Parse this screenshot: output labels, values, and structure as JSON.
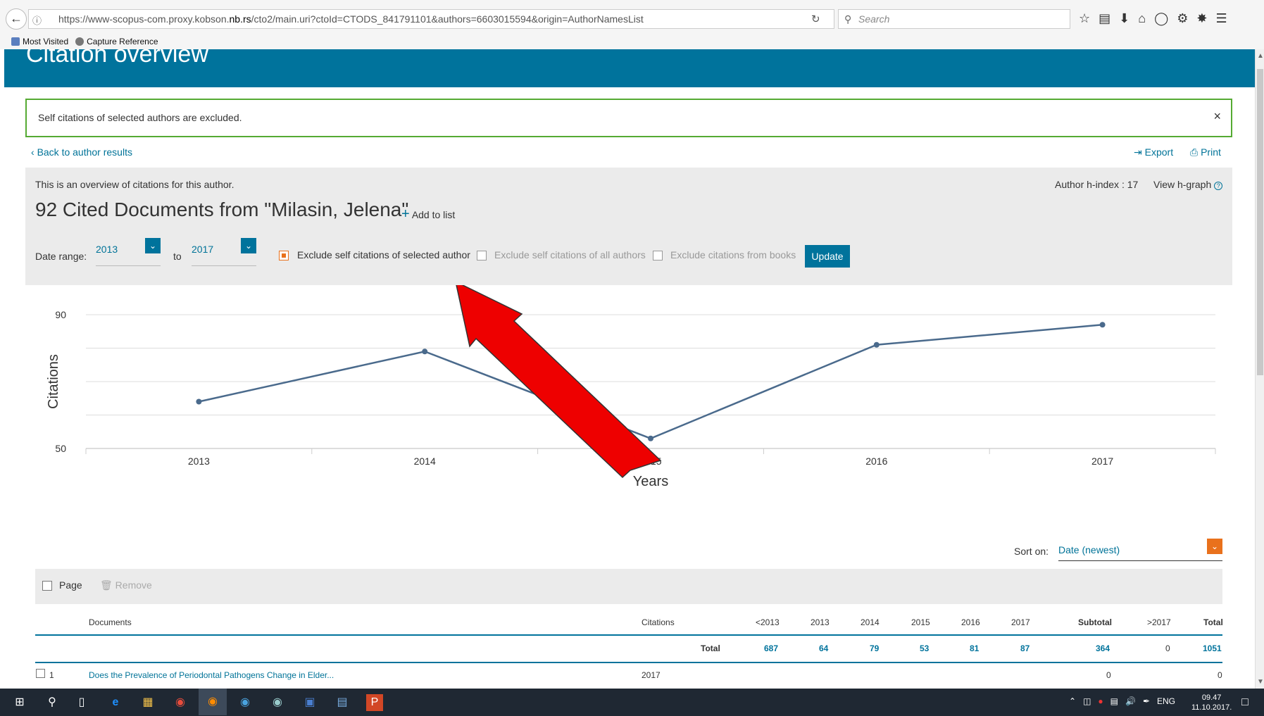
{
  "browser": {
    "url_prefix": "https://www-scopus-com.proxy.kobson.",
    "url_host": "nb.rs",
    "url_suffix": "/cto2/main.uri?ctoId=CTODS_841791101&authors=6603015594&origin=AuthorNamesList",
    "search_placeholder": "Search",
    "bookmarks": [
      "Most Visited",
      "Capture Reference"
    ]
  },
  "page": {
    "title": "Citation overview",
    "notice": "Self citations of selected authors are excluded.",
    "back_link": "Back to author results",
    "export": "Export",
    "print": "Print",
    "overview_text": "This is an overview of citations for this author.",
    "heading": "92 Cited Documents from  \"Milasin, Jelena\"",
    "add_to_list": "Add to list",
    "h_index": "Author h-index : 17",
    "view_h_graph": "View h-graph",
    "date_range_label": "Date range:",
    "date_from": "2013",
    "to_label": "to",
    "date_to": "2017",
    "exclude_selected": "Exclude self citations of selected author",
    "exclude_all": "Exclude self citations of all authors",
    "exclude_books": "Exclude citations from books",
    "update": "Update",
    "sort_label": "Sort on:",
    "sort_value": "Date (newest)",
    "page_label": "Page",
    "remove_label": "Remove"
  },
  "chart_data": {
    "type": "line",
    "x": [
      "2013",
      "2014",
      "2015",
      "2016",
      "2017"
    ],
    "series": [
      {
        "values": [
          64,
          79,
          53,
          81,
          87
        ]
      }
    ],
    "xlabel": "Years",
    "ylabel": "Citations",
    "yticks": [
      "50",
      "90"
    ],
    "ylim": [
      50,
      90
    ],
    "grid": true,
    "color": "#4a6a8c"
  },
  "table": {
    "headers": [
      "Documents",
      "Citations",
      "<2013",
      "2013",
      "2014",
      "2015",
      "2016",
      "2017",
      "Subtotal",
      ">2017",
      "Total"
    ],
    "total_label": "Total",
    "totals": [
      "687",
      "64",
      "79",
      "53",
      "81",
      "87",
      "364",
      "0",
      "1051"
    ],
    "rows": [
      {
        "num": "1",
        "title": "Does the Prevalence of Periodontal Pathogens Change in Elder...",
        "year": "2017",
        "subtotal": "0",
        "total": "0"
      }
    ]
  },
  "taskbar": {
    "lang": "ENG",
    "time": "09.47",
    "date": "11.10.2017."
  }
}
